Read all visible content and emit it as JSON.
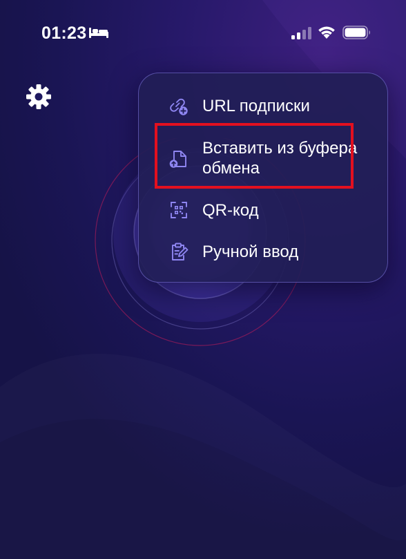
{
  "status_bar": {
    "time": "01:23",
    "focus_icon": "bed-icon",
    "signal_icon": "cellular-signal-icon",
    "wifi_icon": "wifi-icon",
    "battery_icon": "battery-icon"
  },
  "toolbar": {
    "settings_icon": "gear-icon"
  },
  "menu": {
    "items": [
      {
        "label": "URL подписки",
        "icon": "link-plus-icon"
      },
      {
        "label": "Вставить из буфера обмена",
        "icon": "file-upload-icon"
      },
      {
        "label": "QR-код",
        "icon": "qr-scan-icon"
      },
      {
        "label": "Ручной ввод",
        "icon": "clipboard-edit-icon"
      }
    ]
  },
  "colors": {
    "background": "#1d175c",
    "menu_background": "#211e56",
    "icon_accent": "#8f86f2",
    "highlight": "#e3101f"
  }
}
